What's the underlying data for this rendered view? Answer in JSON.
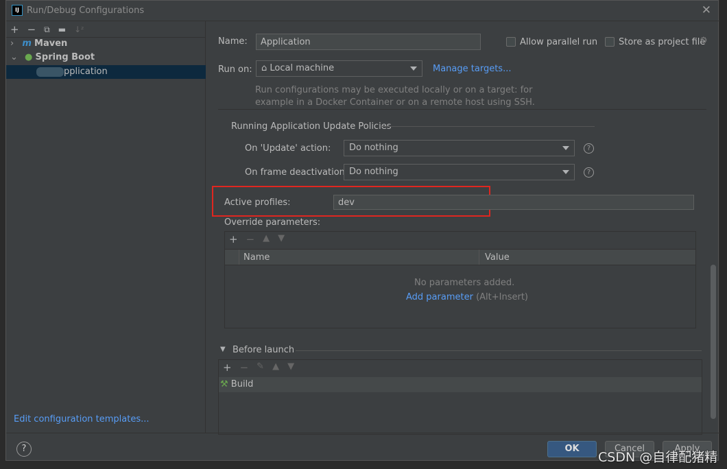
{
  "window": {
    "title": "Run/Debug Configurations",
    "logo": "IJ"
  },
  "left": {
    "toolbar": [
      "plus-icon",
      "minus-icon",
      "copy-icon",
      "new-folder-icon",
      "sort-icon"
    ],
    "tree": [
      {
        "label": "Maven",
        "expanded": false
      },
      {
        "label": "Spring Boot",
        "expanded": true
      },
      {
        "label": "pplication",
        "selected": true
      }
    ],
    "edit_templates": "Edit configuration templates..."
  },
  "form": {
    "name_label": "Name:",
    "name_value": "Application",
    "allow_parallel": "Allow parallel run",
    "store_project": "Store as project file",
    "run_on_label": "Run on:",
    "run_on_value": "Local machine",
    "manage_targets": "Manage targets...",
    "run_on_hint_1": "Run configurations may be executed locally or on a target: for",
    "run_on_hint_2": "example in a Docker Container or on a remote host using SSH.",
    "policies_title": "Running Application Update Policies",
    "update_label": "On 'Update' action:",
    "update_value": "Do nothing",
    "frame_label": "On frame deactivation:",
    "frame_value": "Do nothing",
    "profiles_label": "Active profiles:",
    "profiles_value": "dev",
    "override_label": "Override parameters:",
    "col_name": "Name",
    "col_value": "Value",
    "no_params": "No parameters added.",
    "add_param": "Add parameter",
    "add_param_shortcut": "(Alt+Insert)",
    "before_launch": "Before launch",
    "build": "Build"
  },
  "buttons": {
    "ok": "OK",
    "cancel": "Cancel",
    "apply": "Apply",
    "help": "?"
  },
  "watermark": "CSDN @自律配猪精",
  "colors": {
    "highlight": "#e0261f",
    "accent": "#589df6",
    "ok": "#365880"
  }
}
